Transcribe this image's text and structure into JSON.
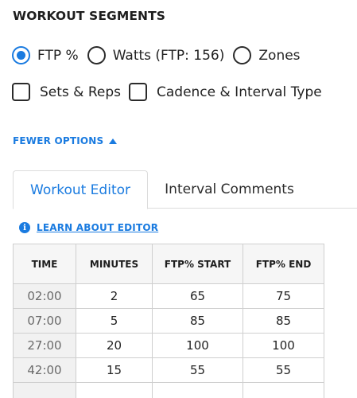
{
  "section_title": "WORKOUT SEGMENTS",
  "display_mode": {
    "options": [
      {
        "label": "FTP %",
        "checked": true
      },
      {
        "label": "Watts (FTP: 156)",
        "checked": false
      },
      {
        "label": "Zones",
        "checked": false
      }
    ]
  },
  "checkboxes": [
    {
      "label": "Sets & Reps",
      "checked": false
    },
    {
      "label": "Cadence & Interval Type",
      "checked": false
    }
  ],
  "fewer_options_label": "FEWER OPTIONS",
  "tabs": [
    {
      "label": "Workout Editor",
      "active": true
    },
    {
      "label": "Interval Comments",
      "active": false
    }
  ],
  "learn_link": "LEARN ABOUT EDITOR",
  "table": {
    "headers": [
      "TIME",
      "MINUTES",
      "FTP% START",
      "FTP% END"
    ],
    "rows": [
      [
        "02:00",
        "2",
        "65",
        "75"
      ],
      [
        "07:00",
        "5",
        "85",
        "85"
      ],
      [
        "27:00",
        "20",
        "100",
        "100"
      ],
      [
        "42:00",
        "15",
        "55",
        "55"
      ],
      [
        "",
        "",
        "",
        ""
      ]
    ]
  },
  "colors": {
    "accent": "#1a7be0"
  },
  "icons": {
    "info": "info-icon",
    "fewer_caret": "caret-up-icon"
  }
}
